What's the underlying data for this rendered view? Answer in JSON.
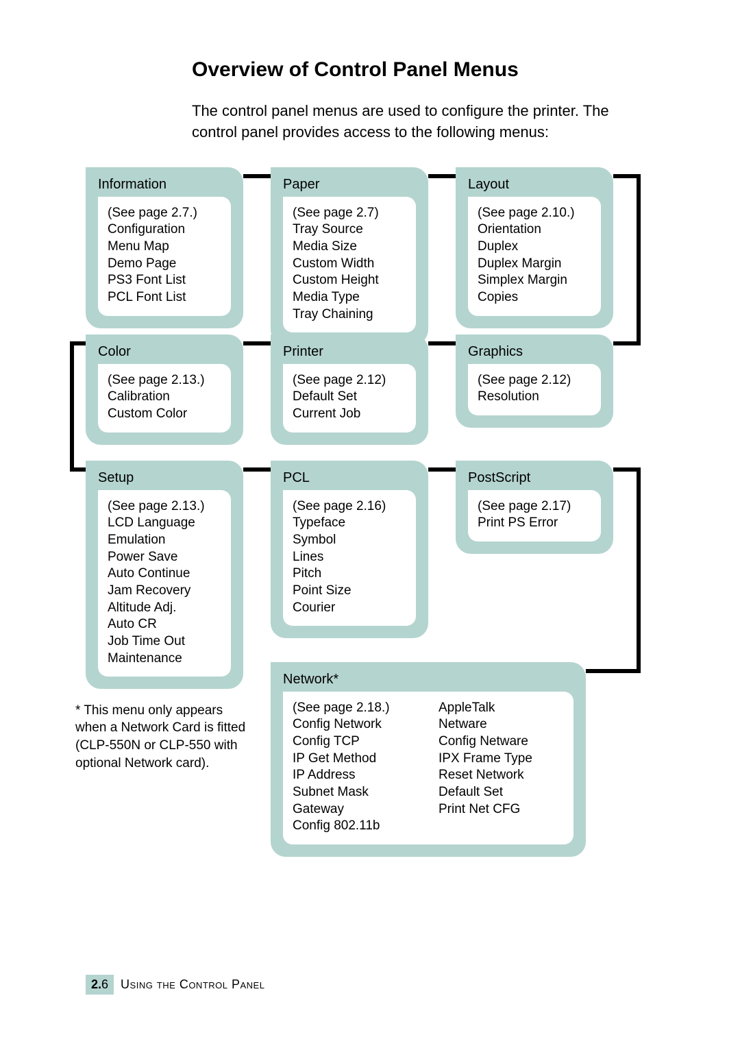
{
  "heading": "Overview of Control Panel Menus",
  "intro": "The control panel menus are used to configure the printer. The control panel provides access to the following menus:",
  "footnote": "* This menu only appears when a Network Card is fitted (CLP-550N or CLP-550 with optional Network card).",
  "footer": {
    "chapter": "2.",
    "page": "6",
    "label": "Using the Control Panel"
  },
  "menus": {
    "information": {
      "title": "Information",
      "body": "(See page 2.7.)\nConfiguration\nMenu Map\nDemo Page\nPS3 Font List\nPCL Font List"
    },
    "paper": {
      "title": "Paper",
      "body": "(See page 2.7)\nTray Source\nMedia Size\nCustom Width\nCustom Height\nMedia Type\nTray Chaining"
    },
    "layout": {
      "title": "Layout",
      "body": "(See page 2.10.)\nOrientation\nDuplex\nDuplex Margin\nSimplex Margin\nCopies"
    },
    "color": {
      "title": "Color",
      "body": "(See page 2.13.)\nCalibration\nCustom Color"
    },
    "printer": {
      "title": "Printer",
      "body": "(See page 2.12)\nDefault Set\nCurrent Job"
    },
    "graphics": {
      "title": "Graphics",
      "body": "(See page 2.12)\nResolution"
    },
    "setup": {
      "title": "Setup",
      "body": "(See page 2.13.)\nLCD Language\nEmulation\nPower Save\nAuto Continue\nJam Recovery\nAltitude Adj.\nAuto CR\nJob Time Out\nMaintenance"
    },
    "pcl": {
      "title": "PCL",
      "body": "(See page 2.16)\nTypeface\nSymbol\nLines\nPitch\nPoint Size\nCourier"
    },
    "postscript": {
      "title": "PostScript",
      "body": "(See page 2.17)\nPrint PS Error"
    },
    "network": {
      "title": "Network*",
      "col1": "(See page 2.18.)\nConfig Network\nConfig TCP\nIP Get Method\nIP Address\nSubnet Mask\nGateway\nConfig 802.11b",
      "col2": "AppleTalk\nNetware\nConfig Netware\nIPX Frame Type\nReset Network\nDefault Set\nPrint Net CFG"
    }
  }
}
